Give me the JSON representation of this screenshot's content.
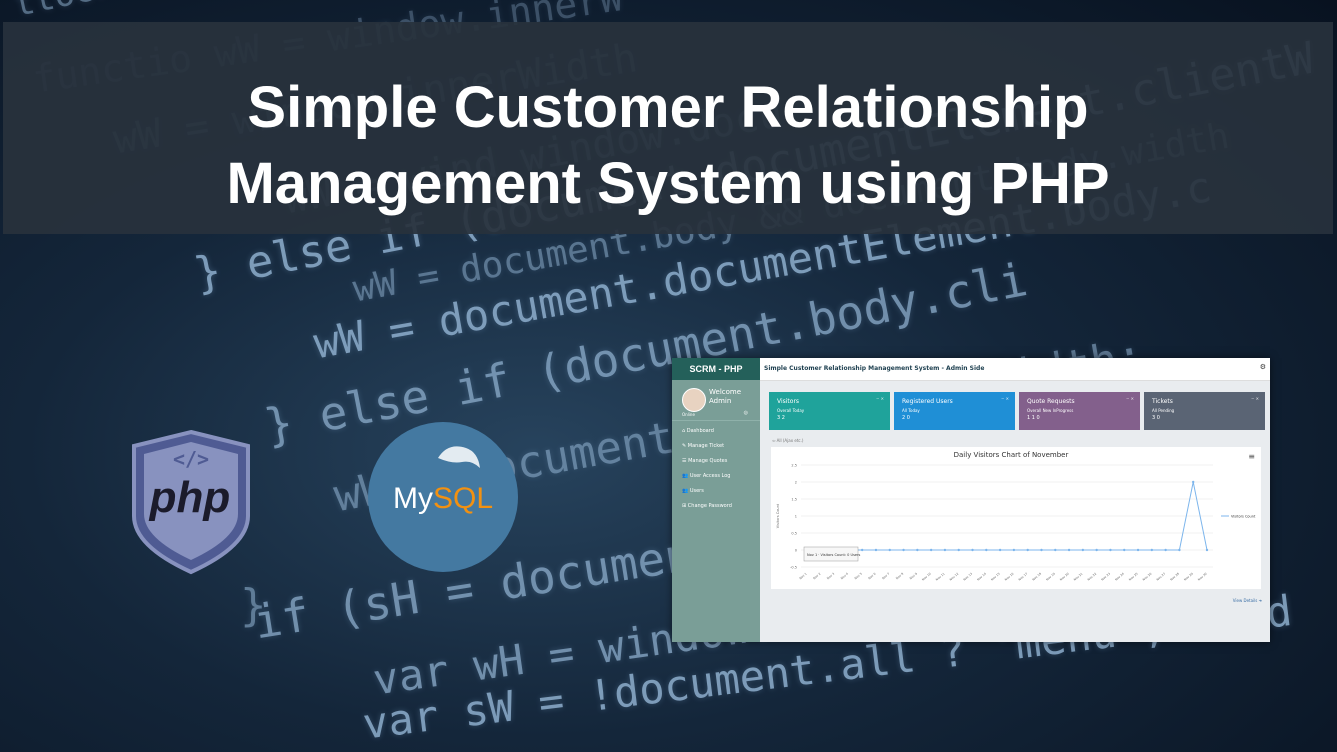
{
  "banner": {
    "title_line1": "Simple Customer Relationship",
    "title_line2": "Management System using PHP"
  },
  "background_code": [
    "ttoen!=sell/",
    "functio wW = window.innerW",
    "wW = window.innerWidth",
    "wW = wind window.docu",
    "} else if (document.documentElement.clientW",
    "wW = document.documentElement.body.c",
    "wW = document.body && document.body.width",
    "} else if (document.body.cli",
    "wW = document.body.clientWidth;",
    "}",
    "if (sH = document.all",
    "var wH = window.innerH",
    "var sW = !document.all ? 'menu', 'wid"
  ],
  "logos": {
    "php": "php",
    "php_code": "</>",
    "mysql_prefix": "My",
    "mysql_suffix": "SQL"
  },
  "app": {
    "brand": "SCRM - PHP",
    "welcome": "Welcome",
    "user": "Admin",
    "online": "Online",
    "header_title": "Simple Customer Relationship Management System - Admin Side",
    "nav": [
      {
        "icon": "dashboard-icon",
        "glyph": "⌂",
        "label": "Dashboard"
      },
      {
        "icon": "ticket-icon",
        "glyph": "✎",
        "label": "Manage Ticket"
      },
      {
        "icon": "quote-icon",
        "glyph": "☰",
        "label": "Manage Quotes"
      },
      {
        "icon": "users-icon",
        "glyph": "👥",
        "label": "User Access Log"
      },
      {
        "icon": "user-icon",
        "glyph": "👥",
        "label": "Users"
      },
      {
        "icon": "password-icon",
        "glyph": "⊞",
        "label": "Change Password"
      }
    ],
    "cards": [
      {
        "title": "Visitors",
        "labels": "Overall    Today",
        "values": "3          2",
        "color": "#1fa39b"
      },
      {
        "title": "Registered Users",
        "labels": "All    Today",
        "values": "2      0",
        "color": "#1f8fd6"
      },
      {
        "title": "Quote Requests",
        "labels": "Overall   New   InProgress",
        "values": "1         1      0",
        "color": "#83608c"
      },
      {
        "title": "Tickets",
        "labels": "All    Pending",
        "values": "3      0",
        "color": "#5a6474"
      }
    ],
    "breadcrumb": "⇦ All (Ajax etc.)",
    "view_details": "View Details ➜"
  },
  "chart_data": {
    "type": "line",
    "title": "Daily Visitors Chart of November",
    "ylabel": "Visitors Count",
    "legend": "Visitors Count",
    "legend_position": "right",
    "tooltip": "Nov 1 · Visitors Count: 0 Users",
    "ylim": [
      -0.5,
      2.5
    ],
    "yticks": [
      -0.5,
      0,
      0.5,
      1,
      1.5,
      2,
      2.5
    ],
    "x": [
      "Nov 1",
      "Nov 2",
      "Nov 3",
      "Nov 4",
      "Nov 5",
      "Nov 6",
      "Nov 7",
      "Nov 8",
      "Nov 9",
      "Nov 10",
      "Nov 11",
      "Nov 12",
      "Nov 13",
      "Nov 14",
      "Nov 15",
      "Nov 16",
      "Nov 17",
      "Nov 18",
      "Nov 19",
      "Nov 20",
      "Nov 21",
      "Nov 22",
      "Nov 23",
      "Nov 24",
      "Nov 25",
      "Nov 26",
      "Nov 27",
      "Nov 28",
      "Nov 29",
      "Nov 30"
    ],
    "series": [
      {
        "name": "Visitors Count",
        "color": "#7cb5ec",
        "values": [
          0,
          0,
          0,
          0,
          0,
          0,
          0,
          0,
          0,
          0,
          0,
          0,
          0,
          0,
          0,
          0,
          0,
          0,
          0,
          0,
          0,
          0,
          0,
          0,
          0,
          0,
          0,
          0,
          2,
          0
        ]
      }
    ],
    "grid": true
  }
}
